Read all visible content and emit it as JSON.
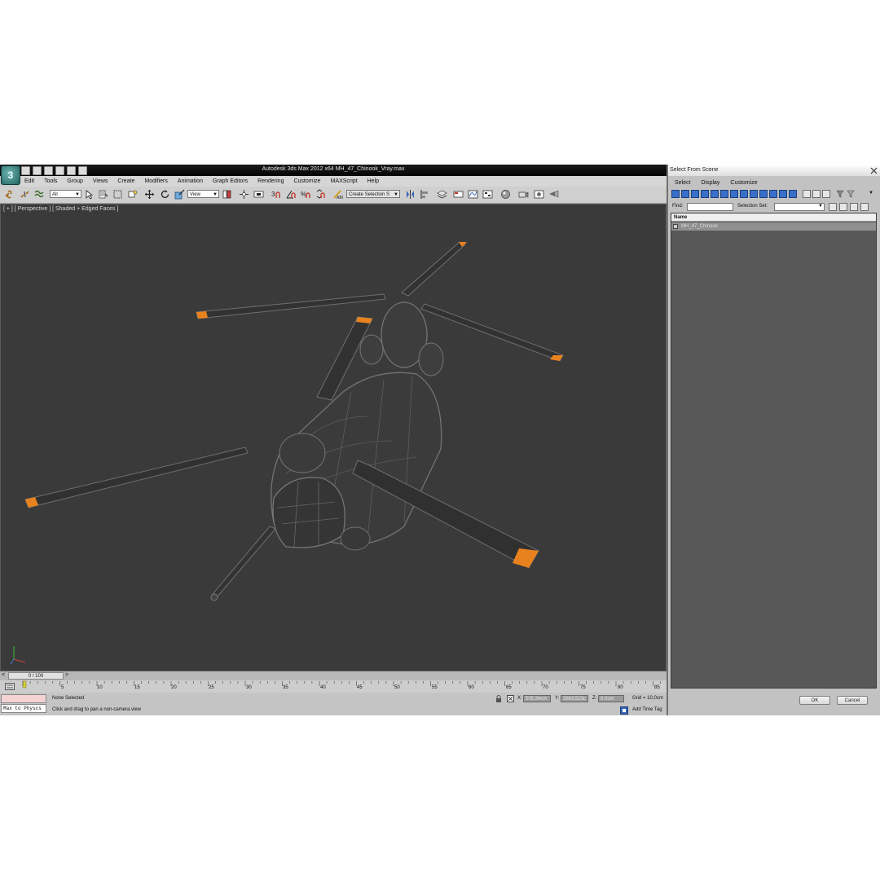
{
  "app": {
    "window_title": "Autodesk 3ds Max  2012 x64      MH_47_Chinook_Vray.max",
    "logo_glyph": "3"
  },
  "menu": [
    "Edit",
    "Tools",
    "Group",
    "Views",
    "Create",
    "Modifiers",
    "Animation",
    "Graph Editors",
    "Rendering",
    "Customize",
    "MAXScript",
    "Help"
  ],
  "toolbar": {
    "filter_dropdown": "All",
    "coord_dropdown": "View",
    "selection_set_dropdown": "Create Selection S"
  },
  "viewport": {
    "label": "[ + ] [ Perspective ] [ Shaded + Edged Faces ]"
  },
  "timeline": {
    "slider_label": "0 / 100",
    "ticks": [
      "5",
      "10",
      "15",
      "20",
      "25",
      "30",
      "35",
      "40",
      "45",
      "50",
      "55",
      "60",
      "65",
      "70",
      "75",
      "80",
      "85"
    ]
  },
  "status": {
    "script_listener": "Max to Physcs",
    "selection": "None Selected",
    "prompt": "Click and drag to pan a non-camera view",
    "x_label": "X:",
    "x_value": "505,34cm",
    "y_label": "Y:",
    "y_value": "3863,523c",
    "z_label": "Z:",
    "z_value": "0,0cm",
    "grid": "Grid = 10,0cm",
    "add_time_tag": "Add Time Tag"
  },
  "dialog": {
    "title": "Select From Scene",
    "menu": [
      "Select",
      "Display",
      "Customize"
    ],
    "find_label": "Find:",
    "selection_set_label": "Selection Set:",
    "column_name": "Name",
    "rows": [
      "MH_47_Chinook"
    ],
    "ok": "OK",
    "cancel": "Cancel"
  },
  "colors": {
    "viewport_bg": "#3a3a3a",
    "blade_tip": "#e8821e",
    "wireframe": "#6f6f6f"
  }
}
